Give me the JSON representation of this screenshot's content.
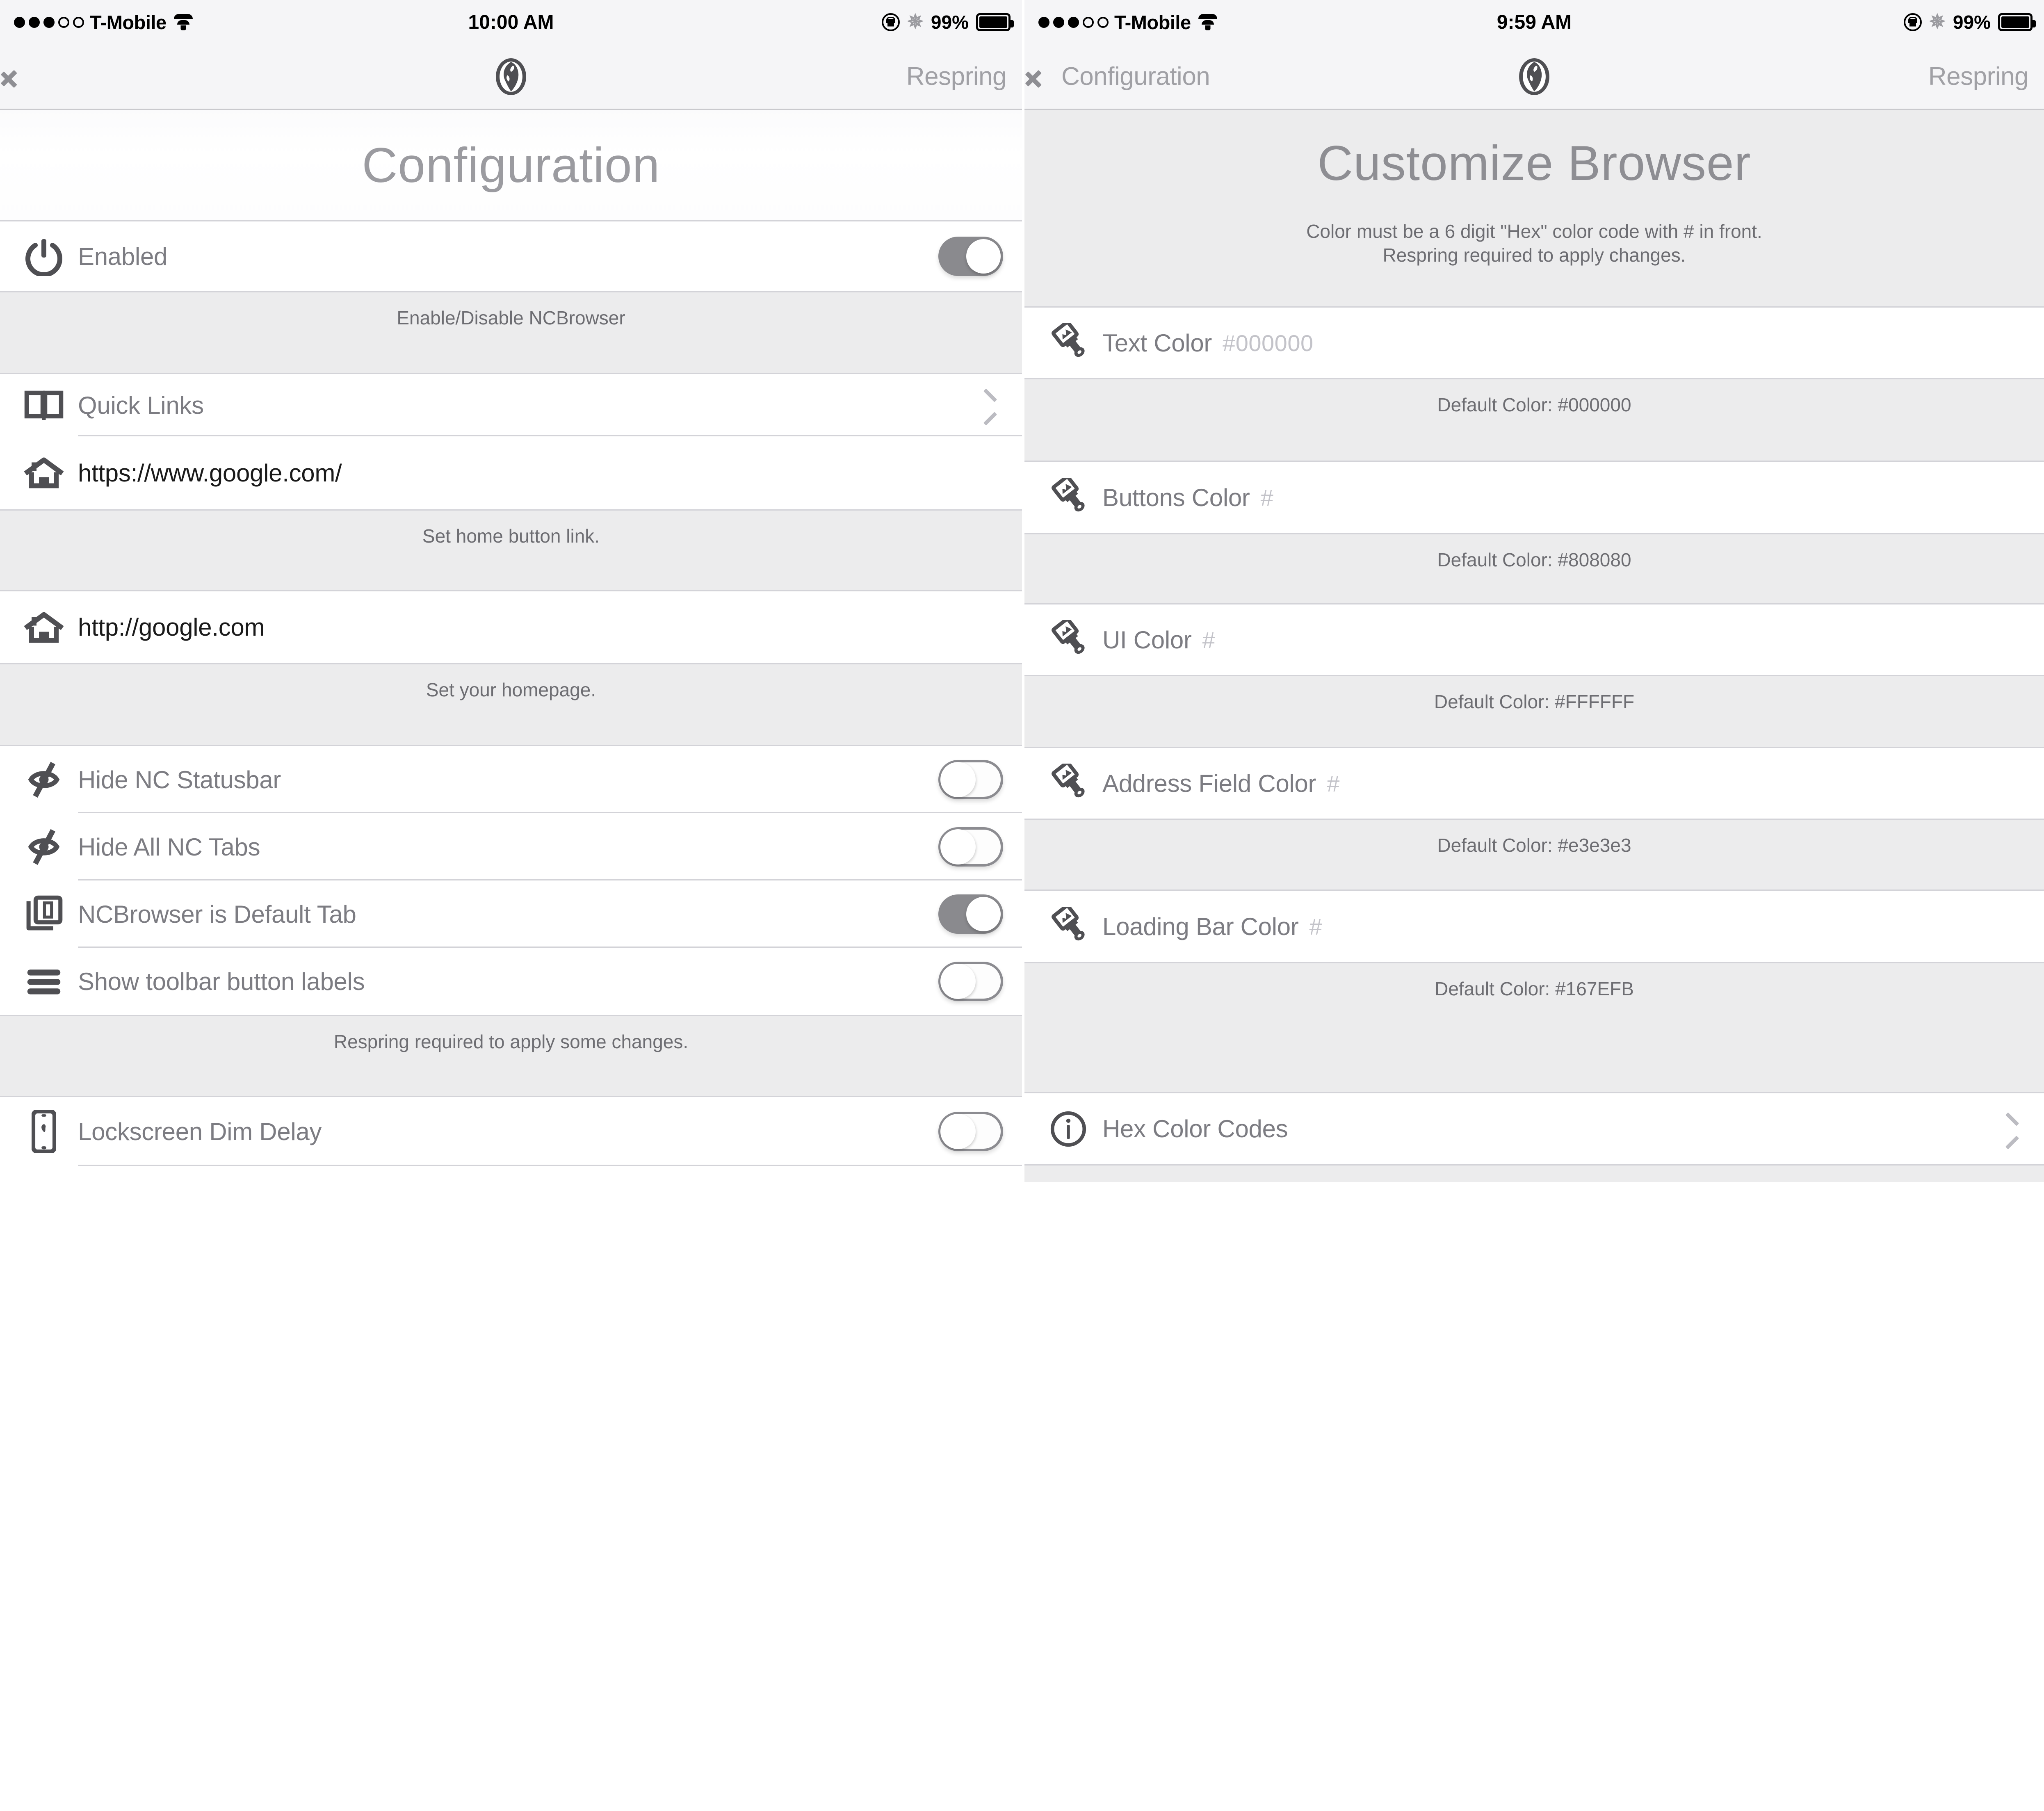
{
  "left": {
    "statusbar": {
      "carrier": "T-Mobile",
      "time": "10:00 AM",
      "battery_pct": "99%",
      "signal_icon": "signal-dots-icon",
      "wifi_icon": "wifi-icon",
      "rotation_lock_icon": "rotation-lock-icon",
      "bluetooth_icon": "bluetooth-icon",
      "battery_icon": "battery-icon"
    },
    "navbar": {
      "back_label": "",
      "back_icon": "chevron-left-icon",
      "center_icon": "globe-icon",
      "action_label": "Respring"
    },
    "page_title": "Configuration",
    "rows": [
      {
        "id": "enabled",
        "icon": "power-icon",
        "label": "Enabled",
        "control": "toggle",
        "state": "on",
        "note": "Enable/Disable NCBrowser"
      },
      {
        "id": "quick-links",
        "icon": "book-icon",
        "label": "Quick Links",
        "control": "chevron"
      },
      {
        "id": "home-button-link",
        "icon": "home-icon",
        "label": "https://www.google.com/",
        "control": "none",
        "note": "Set home button link."
      },
      {
        "id": "homepage",
        "icon": "home-icon",
        "label": "http://google.com",
        "control": "none",
        "note": "Set your homepage."
      },
      {
        "id": "hide-nc-statusbar",
        "icon": "eye-slash-icon",
        "label": "Hide NC Statusbar",
        "control": "toggle",
        "state": "off"
      },
      {
        "id": "hide-all-nc-tabs",
        "icon": "eye-slash-icon",
        "label": "Hide All NC Tabs",
        "control": "toggle",
        "state": "off"
      },
      {
        "id": "ncbrowser-default-tab",
        "icon": "tab-one-icon",
        "label": "NCBrowser is Default Tab",
        "control": "toggle",
        "state": "on"
      },
      {
        "id": "show-toolbar-labels",
        "icon": "hamburger-icon",
        "label": "Show toolbar button labels",
        "control": "toggle",
        "state": "off",
        "note": "Respring required to apply some changes."
      },
      {
        "id": "lockscreen-dim-delay",
        "icon": "iphone-icon",
        "label": "Lockscreen Dim Delay",
        "control": "toggle",
        "state": "off"
      }
    ]
  },
  "right": {
    "statusbar": {
      "carrier": "T-Mobile",
      "time": "9:59 AM",
      "battery_pct": "99%",
      "signal_icon": "signal-dots-icon",
      "wifi_icon": "wifi-icon",
      "rotation_lock_icon": "rotation-lock-icon",
      "bluetooth_icon": "bluetooth-icon",
      "battery_icon": "battery-icon"
    },
    "navbar": {
      "back_label": "Configuration",
      "back_icon": "chevron-left-icon",
      "center_icon": "globe-icon",
      "action_label": "Respring"
    },
    "page_title": "Customize Browser",
    "header_note_line1": "Color must be a 6 digit \"Hex\" color code with # in front.",
    "header_note_line2": "Respring required to apply changes.",
    "rows": [
      {
        "id": "text-color",
        "icon": "paintbrush-icon",
        "label": "Text Color",
        "value": "#000000",
        "note": "Default Color: #000000"
      },
      {
        "id": "buttons-color",
        "icon": "paintbrush-icon",
        "label": "Buttons Color",
        "value": "#",
        "note": "Default Color: #808080"
      },
      {
        "id": "ui-color",
        "icon": "paintbrush-icon",
        "label": "UI Color",
        "value": "#",
        "note": "Default Color: #FFFFFF"
      },
      {
        "id": "address-field-color",
        "icon": "paintbrush-icon",
        "label": "Address Field Color",
        "value": "#",
        "note": "Default Color: #e3e3e3"
      },
      {
        "id": "loading-bar-color",
        "icon": "paintbrush-icon",
        "label": "Loading Bar Color",
        "value": "#",
        "note": "Default Color: #167EFB"
      }
    ],
    "hex_codes_row": {
      "id": "hex-color-codes",
      "icon": "info-icon",
      "label": "Hex Color Codes",
      "control": "chevron"
    }
  },
  "colors": {
    "toggle_on": "#8a8a8e",
    "toggle_off_border": "#8c8c91",
    "section_bg": "#ececed",
    "separator": "#d3d3d8",
    "label_text": "#7c7c82",
    "placeholder_text": "#c3c3c9",
    "nav_tint": "#a0a0a5"
  }
}
